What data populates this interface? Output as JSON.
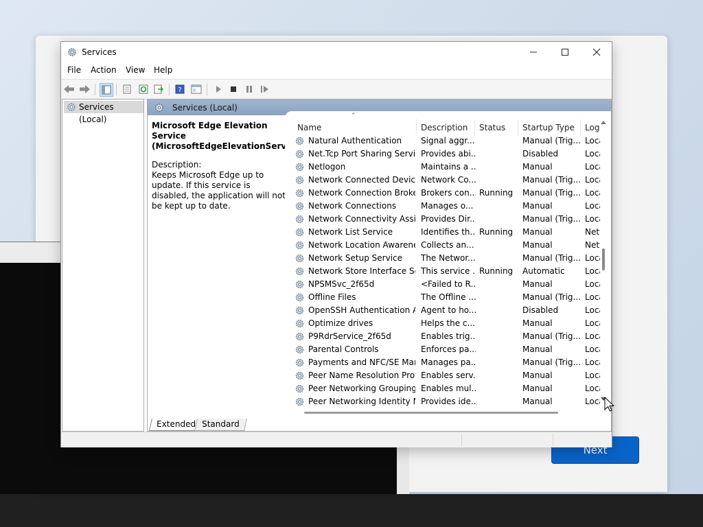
{
  "window": {
    "title": "Services"
  },
  "menu": [
    "File",
    "Action",
    "View",
    "Help"
  ],
  "tree": {
    "root": "Services (Local)"
  },
  "main_header": "Services (Local)",
  "description_pane": {
    "service_title": "Microsoft Edge Elevation Service (MicrosoftEdgeElevationService)",
    "label": "Description:",
    "text": "Keeps Microsoft Edge up to update. If this service is disabled, the application will not be kept up to date."
  },
  "columns": [
    "Name",
    "Description",
    "Status",
    "Startup Type",
    "Log"
  ],
  "services": [
    {
      "name": "Natural Authentication",
      "description": "Signal aggr...",
      "status": "",
      "startup": "Manual (Trig...",
      "logon": "Loca"
    },
    {
      "name": "Net.Tcp Port Sharing Service",
      "description": "Provides abi...",
      "status": "",
      "startup": "Disabled",
      "logon": "Loca"
    },
    {
      "name": "Netlogon",
      "description": "Maintains a ...",
      "status": "",
      "startup": "Manual",
      "logon": "Loca"
    },
    {
      "name": "Network Connected Device...",
      "description": "Network Co...",
      "status": "",
      "startup": "Manual (Trig...",
      "logon": "Loca"
    },
    {
      "name": "Network Connection Broker",
      "description": "Brokers con...",
      "status": "Running",
      "startup": "Manual (Trig...",
      "logon": "Loca"
    },
    {
      "name": "Network Connections",
      "description": "Manages o...",
      "status": "",
      "startup": "Manual",
      "logon": "Loca"
    },
    {
      "name": "Network Connectivity Assis...",
      "description": "Provides Dir...",
      "status": "",
      "startup": "Manual (Trig...",
      "logon": "Loca"
    },
    {
      "name": "Network List Service",
      "description": "Identifies th...",
      "status": "Running",
      "startup": "Manual",
      "logon": "Netw"
    },
    {
      "name": "Network Location Awareness",
      "description": "Collects an...",
      "status": "",
      "startup": "Manual",
      "logon": "Netw"
    },
    {
      "name": "Network Setup Service",
      "description": "The Networ...",
      "status": "",
      "startup": "Manual (Trig...",
      "logon": "Loca"
    },
    {
      "name": "Network Store Interface Ser...",
      "description": "This service ...",
      "status": "Running",
      "startup": "Automatic",
      "logon": "Loca"
    },
    {
      "name": "NPSMSvc_2f65d",
      "description": "<Failed to R...",
      "status": "",
      "startup": "Manual",
      "logon": "Loca"
    },
    {
      "name": "Offline Files",
      "description": "The Offline ...",
      "status": "",
      "startup": "Manual (Trig...",
      "logon": "Loca"
    },
    {
      "name": "OpenSSH Authentication A...",
      "description": "Agent to ho...",
      "status": "",
      "startup": "Disabled",
      "logon": "Loca"
    },
    {
      "name": "Optimize drives",
      "description": "Helps the c...",
      "status": "",
      "startup": "Manual",
      "logon": "Loca"
    },
    {
      "name": "P9RdrService_2f65d",
      "description": "Enables trig...",
      "status": "",
      "startup": "Manual (Trig...",
      "logon": "Loca"
    },
    {
      "name": "Parental Controls",
      "description": "Enforces pa...",
      "status": "",
      "startup": "Manual",
      "logon": "Loca"
    },
    {
      "name": "Payments and NFC/SE Man...",
      "description": "Manages pa...",
      "status": "",
      "startup": "Manual (Trig...",
      "logon": "Loca"
    },
    {
      "name": "Peer Name Resolution Prot...",
      "description": "Enables serv...",
      "status": "",
      "startup": "Manual",
      "logon": "Loca"
    },
    {
      "name": "Peer Networking Grouping",
      "description": "Enables mul...",
      "status": "",
      "startup": "Manual",
      "logon": "Loca"
    },
    {
      "name": "Peer Networking Identity M...",
      "description": "Provides ide...",
      "status": "",
      "startup": "Manual",
      "logon": "Loca"
    }
  ],
  "tabs": [
    "Extended",
    "Standard"
  ],
  "background": {
    "next_label": "Next"
  },
  "colors": {
    "accent": "#0a64c8",
    "header_band": "#9fb6cd",
    "taskbar": "#202020"
  }
}
